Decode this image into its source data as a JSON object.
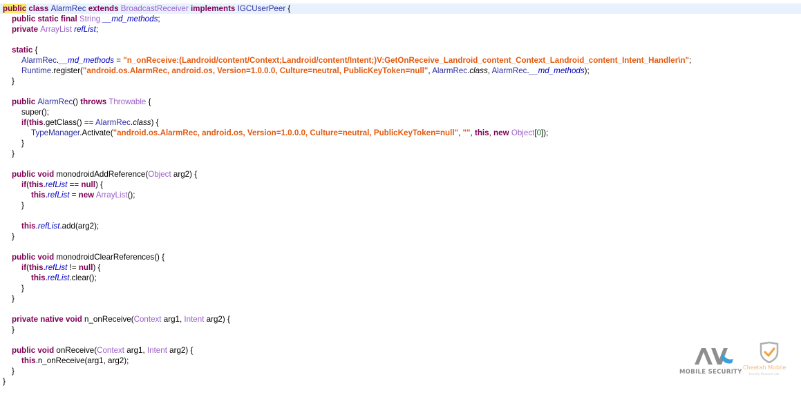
{
  "code": {
    "l1": {
      "public": "public",
      "class_kw": " class ",
      "class_name": "AlarmRec",
      "extends_kw": " extends ",
      "base": "BroadcastReceiver",
      "implements_kw": " implements ",
      "iface": "IGCUserPeer",
      "brace": " {"
    },
    "l2": {
      "mods": "public static final ",
      "type": "String",
      "sp": " ",
      "field": "__md_methods",
      "end": ";"
    },
    "l3": {
      "mods": "private ",
      "type": "ArrayList",
      "sp": " ",
      "field": "refList",
      "end": ";"
    },
    "l5": {
      "kw": "static",
      "brace": " {"
    },
    "l6": {
      "cls": "AlarmRec",
      "dot": ".",
      "field": "__md_methods",
      "eq": " = ",
      "str": "\"n_onReceive:(Landroid/content/Context;Landroid/content/Intent;)V:GetOnReceive_Landroid_content_Context_Landroid_content_Intent_Handler\\n\"",
      "end": ";"
    },
    "l7": {
      "cls": "Runtime",
      "call": ".register(",
      "str": "\"android.os.AlarmRec, android.os, Version=1.0.0.0, Culture=neutral, PublicKeyToken=null\"",
      "sep1": ", ",
      "cls2": "AlarmRec",
      "dot2": ".",
      "classkw": "class",
      "sep2": ", ",
      "cls3": "AlarmRec",
      "dot3": ".",
      "field": "__md_methods",
      "end": ");"
    },
    "l8": {
      "brace": "}"
    },
    "l10": {
      "public": "public ",
      "name": "AlarmRec",
      "parens": "() ",
      "throws": "throws",
      "sp": " ",
      "type": "Throwable",
      "brace": " {"
    },
    "l11": {
      "text": "super();"
    },
    "l12": {
      "if": "if",
      "open": "(",
      "this": "this",
      "mid": ".getClass() == ",
      "cls": "AlarmRec",
      "dot": ".",
      "classkw": "class",
      "end": ") {"
    },
    "l13": {
      "cls": "TypeManager",
      "call": ".Activate(",
      "str": "\"android.os.AlarmRec, android.os, Version=1.0.0.0, Culture=neutral, PublicKeyToken=null\"",
      "sep": ", ",
      "str2": "\"\"",
      "sep2": ", ",
      "this": "this",
      "sep3": ", ",
      "new": "new",
      "sp": " ",
      "type": "Object",
      "br1": "[",
      "num": "0",
      "end": "]);"
    },
    "l14": {
      "brace": "}"
    },
    "l15": {
      "brace": "}"
    },
    "l17": {
      "mods": "public void ",
      "name": "monodroidAddReference(",
      "type": "Object",
      "rest": " arg2) {"
    },
    "l18": {
      "if": "if",
      "open": "(",
      "this": "this",
      "dot": ".",
      "field": "refList",
      "mid": " == ",
      "null": "null",
      "end": ") {"
    },
    "l19": {
      "this": "this",
      "dot": ".",
      "field": "refList",
      "mid": " = ",
      "new": "new",
      "sp": " ",
      "type": "ArrayList",
      "end": "();"
    },
    "l20": {
      "brace": "}"
    },
    "l22": {
      "this": "this",
      "dot": ".",
      "field": "refList",
      "end": ".add(arg2);"
    },
    "l23": {
      "brace": "}"
    },
    "l25": {
      "mods": "public void ",
      "name": "monodroidClearReferences() {"
    },
    "l26": {
      "if": "if",
      "open": "(",
      "this": "this",
      "dot": ".",
      "field": "refList",
      "mid": " != ",
      "null": "null",
      "end": ") {"
    },
    "l27": {
      "this": "this",
      "dot": ".",
      "field": "refList",
      "end": ".clear();"
    },
    "l28": {
      "brace": "}"
    },
    "l29": {
      "brace": "}"
    },
    "l31": {
      "mods": "private native void ",
      "name": "n_onReceive(",
      "type1": "Context",
      "mid": " arg1, ",
      "type2": "Intent",
      "end": " arg2) {"
    },
    "l32": {
      "brace": "}"
    },
    "l34": {
      "mods": "public void ",
      "name": "onReceive(",
      "type1": "Context",
      "mid": " arg1, ",
      "type2": "Intent",
      "end": " arg2) {"
    },
    "l35": {
      "this": "this",
      "rest": ".n_onReceive(arg1, arg2);"
    },
    "l36": {
      "brace": "}"
    },
    "l37": {
      "brace": "}"
    }
  },
  "watermarks": {
    "avl_caption": "MOBILE SECURITY",
    "cheetah_name": "Cheetah Mobile",
    "cheetah_sub": "Security Research Lab",
    "avl_icon": "avl-logo-icon",
    "cheetah_icon": "cheetah-shield-icon"
  },
  "colors": {
    "keyword": "#7f0055",
    "string": "#e45a10",
    "library_type": "#9b5fc9",
    "app_type": "#2c2ca0",
    "field": "#0000c0",
    "number": "#0a7a12",
    "current_line": "#e8f2fe",
    "highlight": "#f6e96a"
  }
}
